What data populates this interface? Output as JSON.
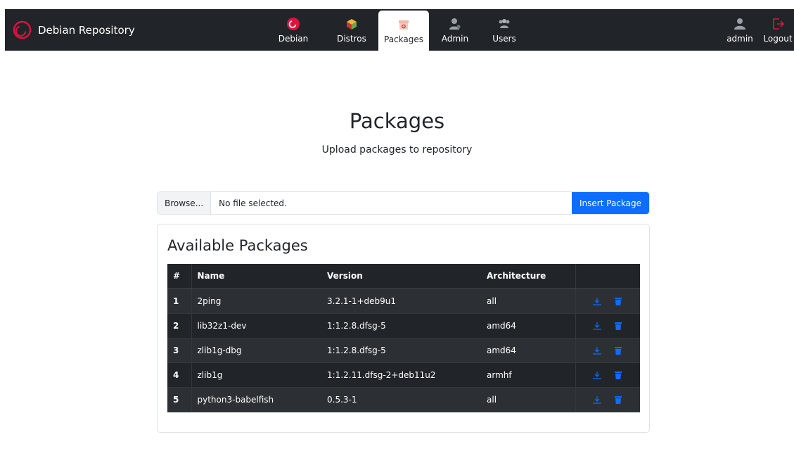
{
  "navbar": {
    "brand": "Debian Repository",
    "items": [
      {
        "label": "Debian",
        "icon": "debian-swirl-icon"
      },
      {
        "label": "Distros",
        "icon": "distros-box-icon"
      },
      {
        "label": "Packages",
        "icon": "package-box-icon"
      },
      {
        "label": "Admin",
        "icon": "admin-user-icon"
      },
      {
        "label": "Users",
        "icon": "users-group-icon"
      }
    ],
    "active": "Packages",
    "user": {
      "label": "admin",
      "icon": "user-icon"
    },
    "logout": {
      "label": "Logout",
      "icon": "logout-icon"
    }
  },
  "page": {
    "title": "Packages",
    "subtitle": "Upload packages to repository"
  },
  "upload": {
    "browse_label": "Browse...",
    "file_status": "No file selected.",
    "submit_label": "Insert Package"
  },
  "packages": {
    "title": "Available Packages",
    "columns": [
      "#",
      "Name",
      "Version",
      "Architecture",
      ""
    ],
    "rows": [
      {
        "num": "1",
        "name": "2ping",
        "version": "3.2.1-1+deb9u1",
        "arch": "all"
      },
      {
        "num": "2",
        "name": "lib32z1-dev",
        "version": "1:1.2.8.dfsg-5",
        "arch": "amd64"
      },
      {
        "num": "3",
        "name": "zlib1g-dbg",
        "version": "1:1.2.8.dfsg-5",
        "arch": "amd64"
      },
      {
        "num": "4",
        "name": "zlib1g",
        "version": "1:1.2.11.dfsg-2+deb11u2",
        "arch": "armhf"
      },
      {
        "num": "5",
        "name": "python3-babelfish",
        "version": "0.5.3-1",
        "arch": "all"
      }
    ]
  },
  "colors": {
    "navbar_bg": "#212529",
    "accent_red": "#e0123e",
    "primary": "#0d6efd",
    "table_odd": "#2c3034",
    "table_even": "#212529"
  }
}
